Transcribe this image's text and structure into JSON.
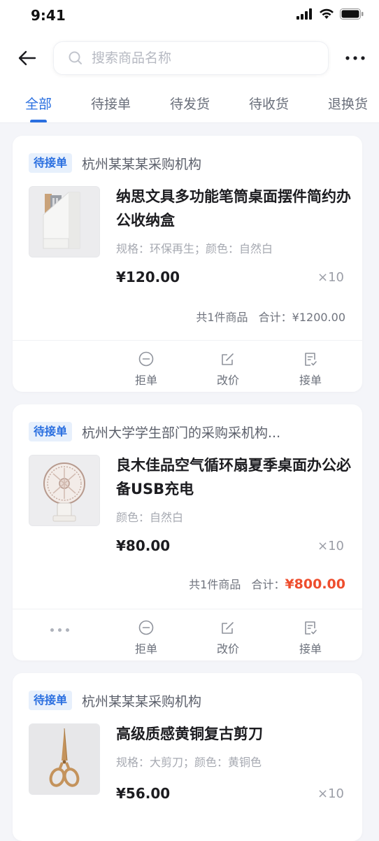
{
  "status_bar": {
    "time": "9:41"
  },
  "search": {
    "placeholder": "搜索商品名称"
  },
  "tabs": [
    {
      "label": "全部",
      "active": true
    },
    {
      "label": "待接单",
      "active": false
    },
    {
      "label": "待发货",
      "active": false
    },
    {
      "label": "待收货",
      "active": false
    },
    {
      "label": "退换货",
      "active": false
    }
  ],
  "colors": {
    "accent": "#2a6fe0",
    "price_highlight": "#ee4d2d",
    "badge_bg": "#e7f0fc"
  },
  "orders": [
    {
      "status": "待接单",
      "org": "杭州某某某采购机构",
      "product_name": "纳思文具多功能笔筒桌面摆件简约办公收纳盒",
      "spec": "规格：环保再生；颜色：自然白",
      "price": "¥120.00",
      "qty": "×10",
      "count_text": "共1件商品",
      "total_label": "合计：",
      "total": "¥1200.00",
      "actions": [
        "拒单",
        "改价",
        "接单"
      ],
      "image_icon": "file-organizer-image"
    },
    {
      "status": "待接单",
      "org": "杭州大学学生部门的采购采机构...",
      "product_name": "良木佳品空气循环扇夏季桌面办公必备USB充电",
      "spec": "颜色：自然白",
      "price": "¥80.00",
      "qty": "×10",
      "count_text": "共1件商品",
      "total_label": "合计：",
      "total": "¥800.00",
      "actions": [
        "拒单",
        "改价",
        "接单"
      ],
      "image_icon": "desk-fan-image"
    },
    {
      "status": "待接单",
      "org": "杭州某某某采购机构",
      "product_name": "高级质感黄铜复古剪刀",
      "spec": "规格：大剪刀；颜色：黄铜色",
      "price": "¥56.00",
      "qty": "×10",
      "image_icon": "scissors-image"
    }
  ]
}
